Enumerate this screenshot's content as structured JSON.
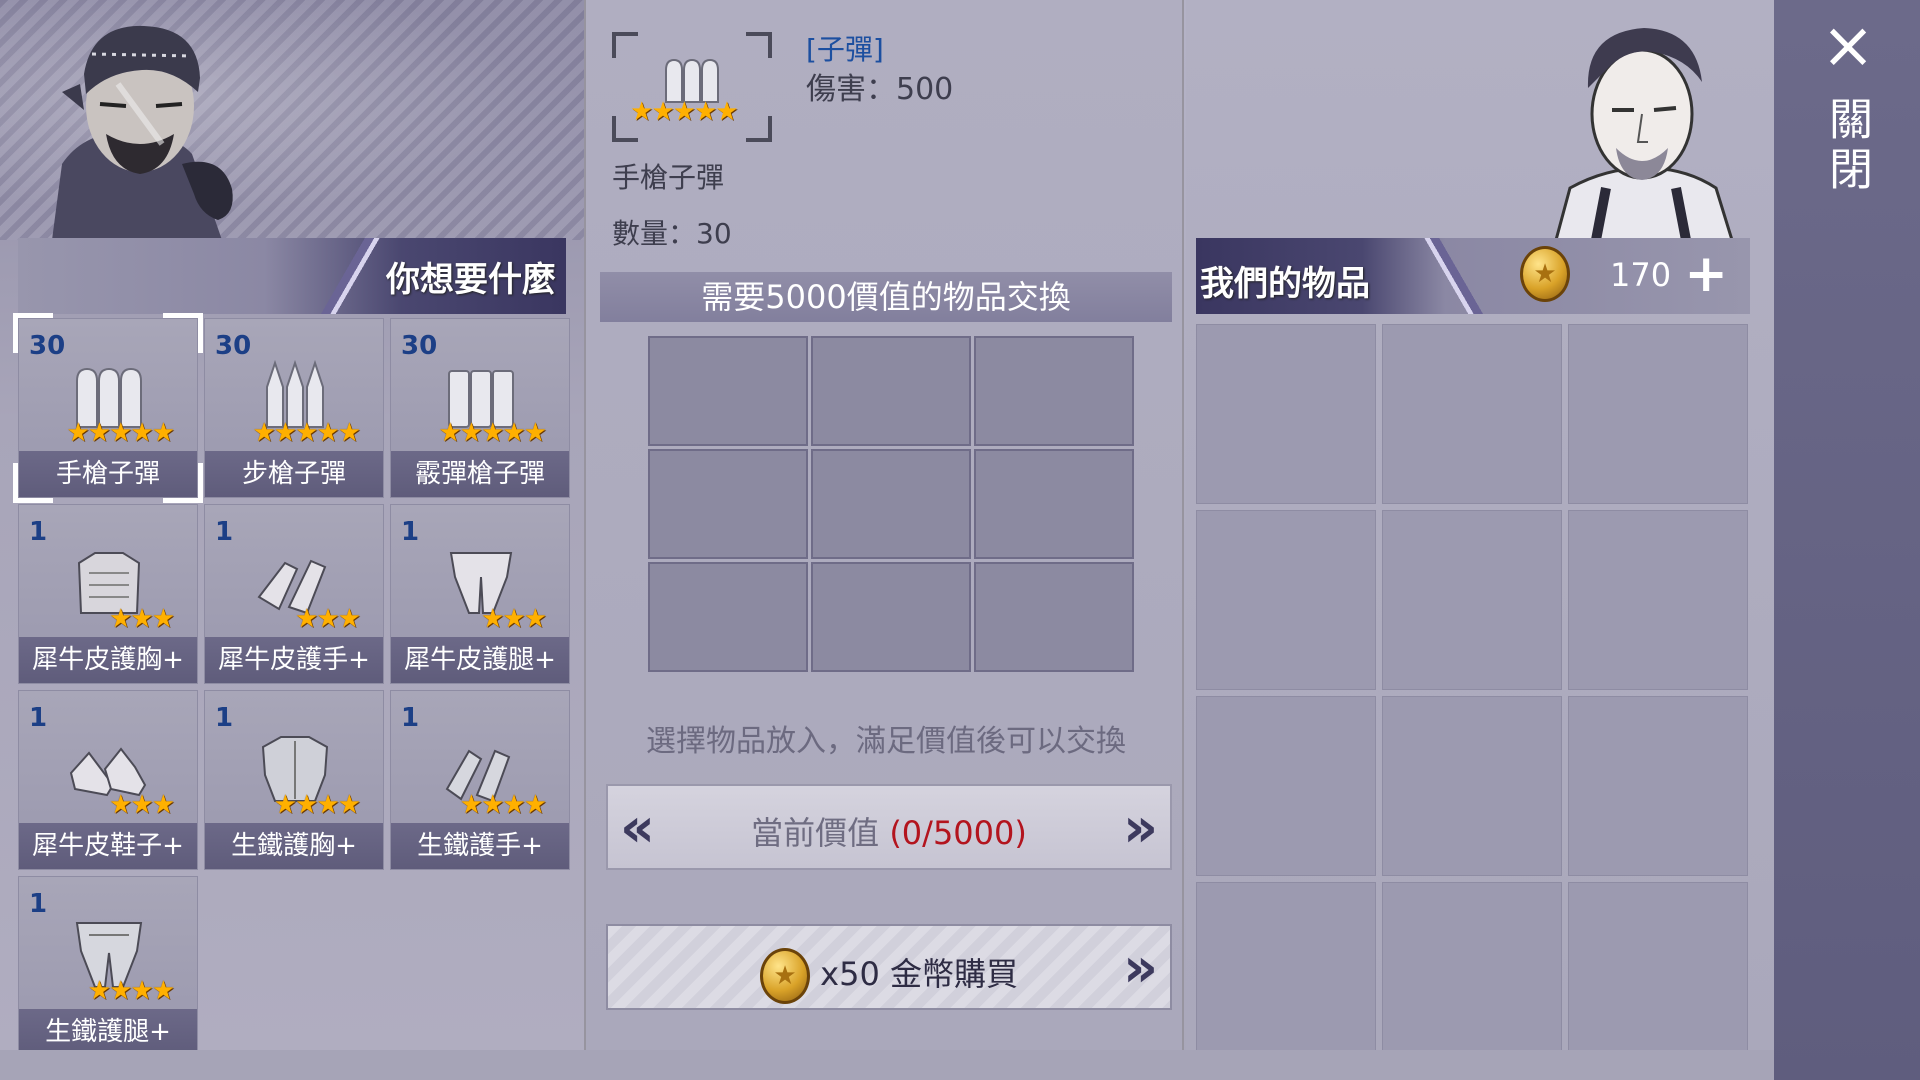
{
  "left_panel": {
    "title": "你想要什麼",
    "items": [
      {
        "count": "30",
        "label": "手槍子彈",
        "stars": 5,
        "icon": "pistol-ammo-icon",
        "selected": true
      },
      {
        "count": "30",
        "label": "步槍子彈",
        "stars": 5,
        "icon": "rifle-ammo-icon"
      },
      {
        "count": "30",
        "label": "霰彈槍子彈",
        "stars": 5,
        "icon": "shotgun-ammo-icon"
      },
      {
        "count": "1",
        "label": "犀牛皮護胸+",
        "stars": 3,
        "icon": "leather-chest-icon"
      },
      {
        "count": "1",
        "label": "犀牛皮護手+",
        "stars": 3,
        "icon": "leather-gloves-icon"
      },
      {
        "count": "1",
        "label": "犀牛皮護腿+",
        "stars": 3,
        "icon": "leather-legs-icon"
      },
      {
        "count": "1",
        "label": "犀牛皮鞋子+",
        "stars": 3,
        "icon": "leather-shoes-icon"
      },
      {
        "count": "1",
        "label": "生鐵護胸+",
        "stars": 4,
        "icon": "iron-chest-icon"
      },
      {
        "count": "1",
        "label": "生鐵護手+",
        "stars": 4,
        "icon": "iron-gloves-icon"
      },
      {
        "count": "1",
        "label": "生鐵護腿+",
        "stars": 4,
        "icon": "iron-legs-icon"
      }
    ]
  },
  "detail": {
    "type": "[子彈]",
    "damage": "傷害：500",
    "name": "手槍子彈",
    "quantity": "數量：30",
    "stars": 5
  },
  "exchange": {
    "need_text": "需要5000價值的物品交換",
    "hint": "選擇物品放入，滿足價值後可以交換",
    "value_label": "當前價值",
    "value_num": "(0/5000)",
    "buy_label": "x50 金幣購買"
  },
  "right_panel": {
    "title": "我們的物品",
    "coins": "170",
    "plus": "+"
  },
  "sidebar": {
    "close_icon": "×",
    "close_label": "關閉"
  },
  "colors": {
    "count_blue": "#1c3f86",
    "value_red": "#b3141e",
    "type_blue": "#1c4fa0"
  }
}
